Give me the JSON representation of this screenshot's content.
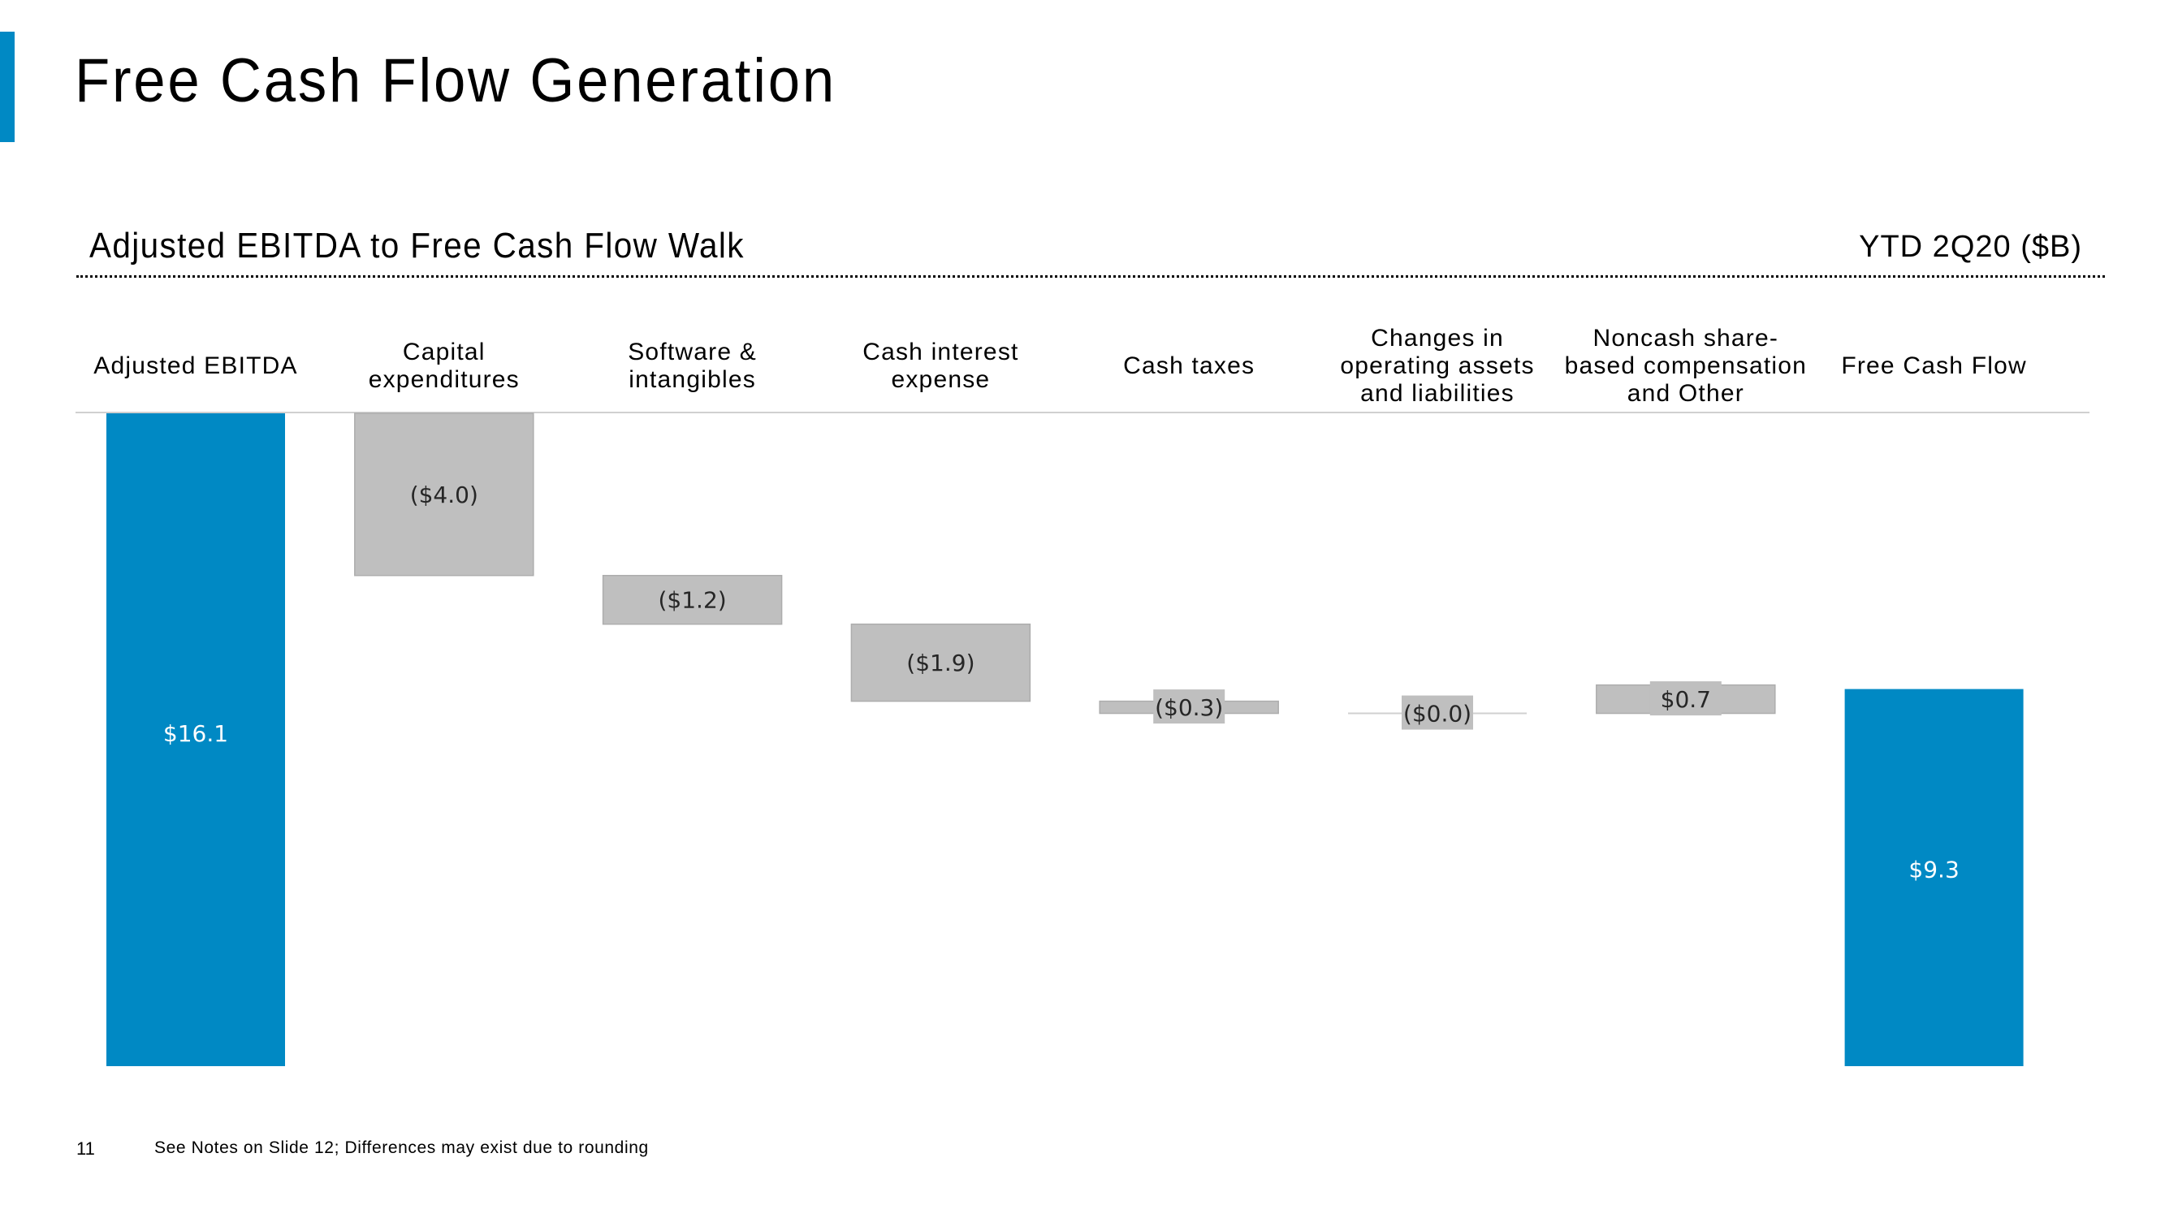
{
  "slide": {
    "title": "Free Cash Flow Generation",
    "subtitle": "Adjusted EBITDA to Free Cash Flow Walk",
    "units_label": "YTD 2Q20 ($B)",
    "page_number": "11",
    "footnote": "See Notes on Slide 12; Differences may exist due to rounding"
  },
  "colors": {
    "accent": "#0089C4",
    "total_bar": "#0089C4",
    "step_bar": "#BFBFBF",
    "total_label": "#FFFFFF",
    "step_label": "#262626"
  },
  "chart_data": {
    "type": "bar",
    "subtype": "waterfall",
    "title": "Adjusted EBITDA to Free Cash Flow Walk",
    "units": "YTD 2Q20 ($B)",
    "xlabel": "",
    "ylabel": "",
    "ylim": [
      0,
      16.1
    ],
    "grid": false,
    "legend": "none",
    "categories": [
      "Adjusted EBITDA",
      "Capital\nexpenditures",
      "Software &\nintangibles",
      "Cash interest\nexpense",
      "Cash taxes",
      "Changes in\noperating assets\nand liabilities",
      "Noncash share-\nbased compensation\nand Other",
      "Free Cash Flow"
    ],
    "values": [
      16.1,
      -4.0,
      -1.2,
      -1.9,
      -0.3,
      -0.0,
      0.7,
      9.3
    ],
    "kinds": [
      "total",
      "step",
      "step",
      "step",
      "step",
      "step",
      "step",
      "total"
    ],
    "labels": [
      "$16.1",
      "($4.0)",
      "($1.2)",
      "($1.9)",
      "($0.3)",
      "($0.0)",
      "$0.7",
      "$9.3"
    ]
  }
}
